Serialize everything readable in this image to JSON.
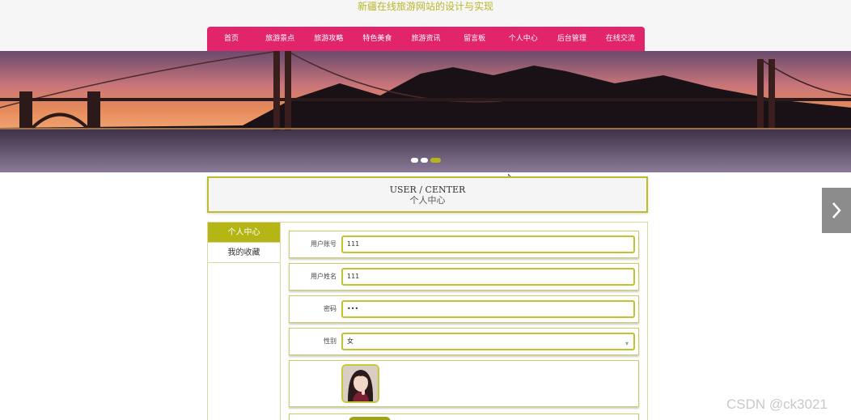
{
  "site": {
    "title": "新疆在线旅游网站的设计与实现"
  },
  "nav": {
    "items": [
      {
        "label": "首页"
      },
      {
        "label": "旅游景点"
      },
      {
        "label": "旅游攻略"
      },
      {
        "label": "特色美食"
      },
      {
        "label": "旅游资讯"
      },
      {
        "label": "留言板"
      },
      {
        "label": "个人中心"
      },
      {
        "label": "后台管理"
      },
      {
        "label": "在线交流"
      }
    ]
  },
  "banner": {
    "slides_total": 3,
    "active_slide": 3
  },
  "center": {
    "title_en": "USER / CENTER",
    "title_cn": "个人中心"
  },
  "side_menu": {
    "items": [
      {
        "label": "个人中心",
        "active": true
      },
      {
        "label": "我的收藏",
        "active": false
      }
    ]
  },
  "form": {
    "account": {
      "label": "用户账号",
      "value": "111"
    },
    "name": {
      "label": "用户姓名",
      "value": "111"
    },
    "password": {
      "label": "密码",
      "value": "•••"
    },
    "gender": {
      "label": "性别",
      "value": "女"
    }
  },
  "watermark": "CSDN @ck3021",
  "colors": {
    "nav": "#e2246a",
    "accent": "#b5b516",
    "title": "#b7b72a"
  }
}
